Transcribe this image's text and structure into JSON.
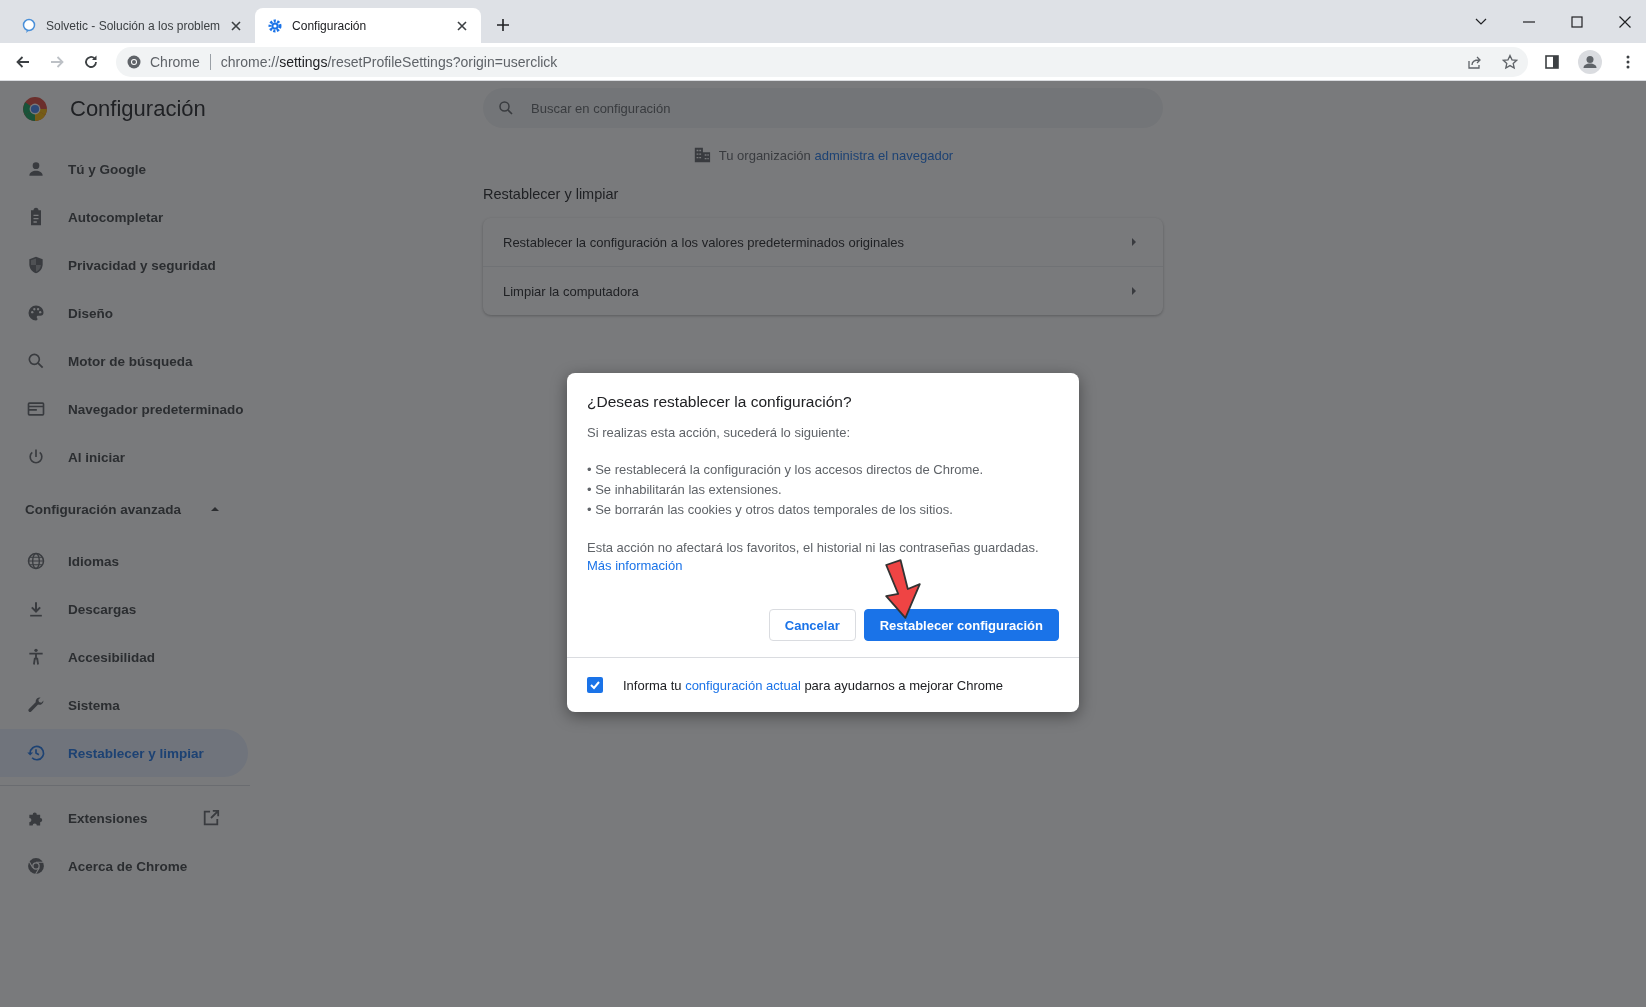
{
  "tabs": [
    {
      "title": "Solvetic - Solución a los problem",
      "selected": false
    },
    {
      "title": "Configuración",
      "selected": true
    }
  ],
  "toolbar": {
    "site_label": "Chrome",
    "url_scheme": "chrome://",
    "url_host": "settings",
    "url_path": "/resetProfileSettings?origin=userclick"
  },
  "sidebar": {
    "title": "Configuración",
    "items": [
      {
        "label": "Tú y Google",
        "selected": false
      },
      {
        "label": "Autocompletar",
        "selected": false
      },
      {
        "label": "Privacidad y seguridad",
        "selected": false
      },
      {
        "label": "Diseño",
        "selected": false
      },
      {
        "label": "Motor de búsqueda",
        "selected": false
      },
      {
        "label": "Navegador predeterminado",
        "selected": false
      },
      {
        "label": "Al iniciar",
        "selected": false
      }
    ],
    "advanced": {
      "label": "Configuración avanzada",
      "expanded": true,
      "items": [
        {
          "label": "Idiomas",
          "selected": false
        },
        {
          "label": "Descargas",
          "selected": false
        },
        {
          "label": "Accesibilidad",
          "selected": false
        },
        {
          "label": "Sistema",
          "selected": false
        },
        {
          "label": "Restablecer y limpiar",
          "selected": true
        }
      ]
    },
    "footer_items": [
      {
        "label": "Extensiones",
        "kind": "external"
      },
      {
        "label": "Acerca de Chrome",
        "kind": "page"
      }
    ]
  },
  "main": {
    "search": {
      "placeholder": "Buscar en configuración"
    },
    "managed_notice": {
      "text": "Tu organización",
      "link": "administra el navegador"
    },
    "section_title": "Restablecer y limpiar",
    "rows": [
      {
        "label": "Restablecer la configuración a los valores predeterminados originales"
      },
      {
        "label": "Limpiar la computadora"
      }
    ]
  },
  "dialog": {
    "title": "¿Deseas restablecer la configuración?",
    "intro": "Si realizas esta acción, sucederá lo siguiente:",
    "bullets": [
      "• Se restablecerá la configuración y los accesos directos de Chrome.",
      "• Se inhabilitarán las extensiones.",
      "• Se borrarán las cookies y otros datos temporales de los sitios."
    ],
    "note": "Esta acción no afectará los favoritos, el historial ni las contraseñas guardadas.",
    "link": "Más información",
    "cancel_button": "Cancelar",
    "confirm_button": "Restablecer configuración",
    "report": {
      "checked": true,
      "text_before": "Informa tu",
      "link": "configuración actual",
      "text_after": "para ayudarnos a mejorar Chrome"
    }
  }
}
